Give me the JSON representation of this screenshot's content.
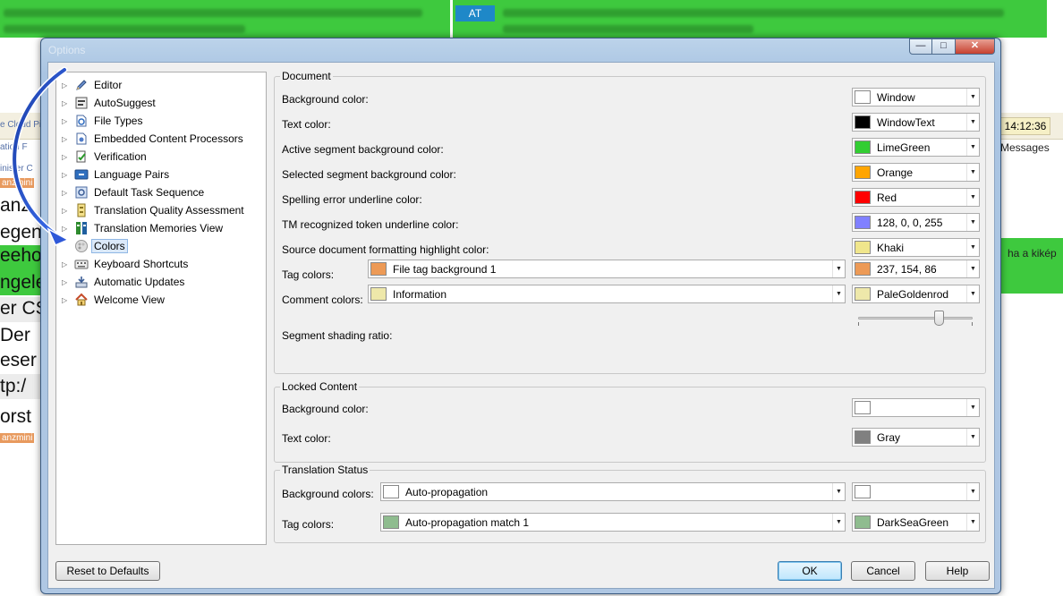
{
  "background_app": {
    "at_label": "AT",
    "time": "14:12:36",
    "messages": "Messages",
    "right_text": "ha a kikép",
    "left_fragments": [
      "anz",
      "egen",
      "eehot",
      "ngele",
      "er CS",
      "Der",
      "eser",
      "tp:/",
      "orst"
    ],
    "left_small": [
      "e Cloud Pi",
      "ation F",
      "inister C",
      "anzmini",
      "anzmini"
    ]
  },
  "dialog": {
    "title": "Options",
    "window_buttons": {
      "minimize": "—",
      "maximize": "□",
      "close": "✕"
    },
    "tree": [
      {
        "label": "Editor",
        "icon": "pencil-icon",
        "expandable": true
      },
      {
        "label": "AutoSuggest",
        "icon": "autosuggest-icon",
        "expandable": true
      },
      {
        "label": "File Types",
        "icon": "file-types-icon",
        "expandable": true
      },
      {
        "label": "Embedded Content Processors",
        "icon": "gear-doc-icon",
        "expandable": true
      },
      {
        "label": "Verification",
        "icon": "verification-icon",
        "expandable": true
      },
      {
        "label": "Language Pairs",
        "icon": "language-pairs-icon",
        "expandable": true
      },
      {
        "label": "Default Task Sequence",
        "icon": "task-sequence-icon",
        "expandable": true
      },
      {
        "label": "Translation Quality Assessment",
        "icon": "quality-assessment-icon",
        "expandable": true
      },
      {
        "label": "Translation Memories View",
        "icon": "translation-memory-icon",
        "expandable": true
      },
      {
        "label": "Colors",
        "icon": "palette-icon",
        "expandable": false,
        "selected": true
      },
      {
        "label": "Keyboard Shortcuts",
        "icon": "keyboard-icon",
        "expandable": true
      },
      {
        "label": "Automatic Updates",
        "icon": "update-icon",
        "expandable": true
      },
      {
        "label": "Welcome View",
        "icon": "home-icon",
        "expandable": true
      }
    ],
    "document": {
      "title": "Document",
      "rows": [
        {
          "label": "Background color:",
          "value": "Window",
          "color": "#ffffff"
        },
        {
          "label": "Text color:",
          "value": "WindowText",
          "color": "#000000"
        },
        {
          "label": "Active segment background color:",
          "value": "LimeGreen",
          "color": "#32cd32"
        },
        {
          "label": "Selected segment background color:",
          "value": "Orange",
          "color": "#ffa500"
        },
        {
          "label": "Spelling error underline color:",
          "value": "Red",
          "color": "#ff0000"
        },
        {
          "label": "TM recognized token underline color:",
          "value": "128, 0, 0, 255",
          "color": "#8080ff"
        },
        {
          "label": "Source document formatting highlight color:",
          "value": "Khaki",
          "color": "#f0e68c"
        }
      ],
      "tag_colors": {
        "label": "Tag colors:",
        "type_value": "File tag background 1",
        "type_color": "#ed9a56",
        "value": "237, 154, 86",
        "color": "#ed9a56"
      },
      "comment_colors": {
        "label": "Comment colors:",
        "type_value": "Information",
        "type_color": "#eee8aa",
        "value": "PaleGoldenrod",
        "color": "#eee8aa"
      },
      "shading": {
        "label": "Segment shading ratio:",
        "level": 0.7
      }
    },
    "locked": {
      "title": "Locked Content",
      "rows": [
        {
          "label": "Background color:",
          "value": "",
          "color": "#ffffff"
        },
        {
          "label": "Text color:",
          "value": "Gray",
          "color": "#808080"
        }
      ]
    },
    "status": {
      "title": "Translation Status",
      "background": {
        "label": "Background colors:",
        "type_value": "Auto-propagation",
        "type_color": "#ffffff",
        "value": "",
        "color": "#ffffff"
      },
      "tags": {
        "label": "Tag colors:",
        "type_value": "Auto-propagation match 1",
        "type_color": "#8fbc8f",
        "value": "DarkSeaGreen",
        "color": "#8fbc8f"
      }
    },
    "buttons": {
      "reset": "Reset to Defaults",
      "ok": "OK",
      "cancel": "Cancel",
      "help": "Help"
    }
  }
}
